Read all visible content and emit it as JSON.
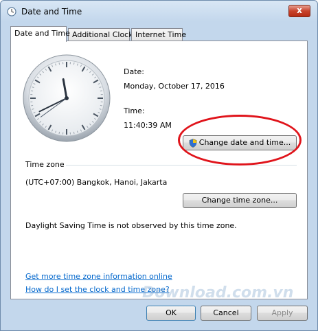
{
  "window": {
    "title": "Date and Time",
    "close_glyph": "x"
  },
  "tabs": [
    {
      "label": "Date and Time",
      "active": true
    },
    {
      "label": "Additional Clocks",
      "active": false
    },
    {
      "label": "Internet Time",
      "active": false
    }
  ],
  "clock": {
    "hour": 11,
    "minute": 40,
    "second": 39
  },
  "date": {
    "label": "Date:",
    "value": "Monday, October 17, 2016"
  },
  "time": {
    "label": "Time:",
    "value": "11:40:39 AM"
  },
  "buttons": {
    "change_date_time": "Change date and time...",
    "change_time_zone": "Change time zone...",
    "ok": "OK",
    "cancel": "Cancel",
    "apply": "Apply"
  },
  "timezone": {
    "header": "Time zone",
    "value": "(UTC+07:00) Bangkok, Hanoi, Jakarta",
    "dst_note": "Daylight Saving Time is not observed by this time zone."
  },
  "links": {
    "more_info": "Get more time zone information online",
    "how_to_set": "How do I set the clock and time zone?"
  },
  "watermark": "Download.com.vn",
  "colors": {
    "link": "#0066cc",
    "highlight_ellipse": "#e0141b"
  }
}
